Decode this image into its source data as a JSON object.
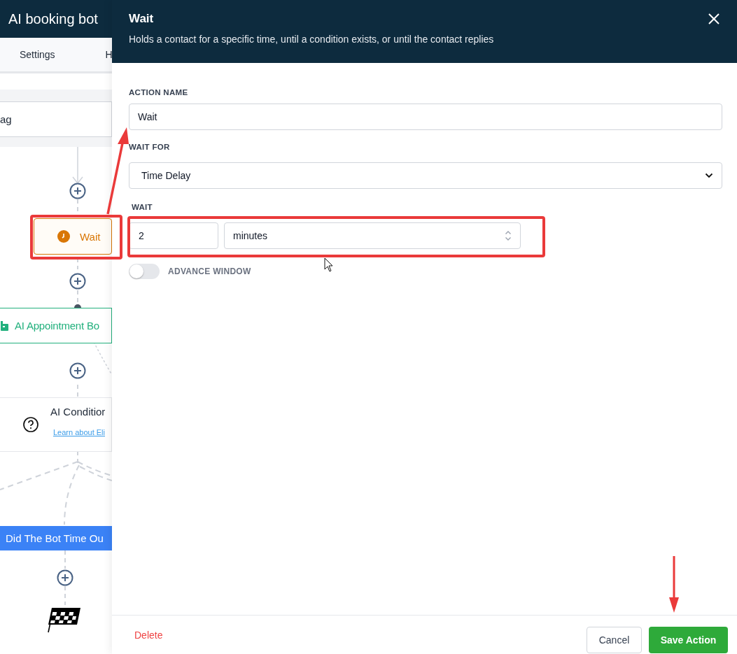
{
  "app": {
    "title": "AI booking bot"
  },
  "tabs": [
    {
      "label": "Settings"
    },
    {
      "label": "H"
    }
  ],
  "canvas": {
    "nodes": [
      {
        "kind": "action",
        "label": "ag"
      },
      {
        "kind": "wait",
        "label": "Wait"
      },
      {
        "kind": "bot",
        "label": "AI Appointment Bo"
      },
      {
        "kind": "condition",
        "label": "AI Conditior",
        "link": "Learn about Eli"
      },
      {
        "kind": "branch",
        "label": "Did The Bot Time Ou"
      },
      {
        "kind": "end"
      }
    ]
  },
  "drawer": {
    "title": "Wait",
    "subtitle": "Holds a contact for a specific time, until a condition exists, or until the contact replies",
    "action_name": {
      "label": "ACTION NAME",
      "value": "Wait"
    },
    "wait_for": {
      "label": "WAIT FOR",
      "value": "Time Delay"
    },
    "wait": {
      "label": "WAIT",
      "amount": "2",
      "unit": "minutes"
    },
    "advance_window": {
      "label": "ADVANCE WINDOW",
      "on": false
    },
    "footer": {
      "delete": "Delete",
      "cancel": "Cancel",
      "save": "Save Action"
    }
  }
}
